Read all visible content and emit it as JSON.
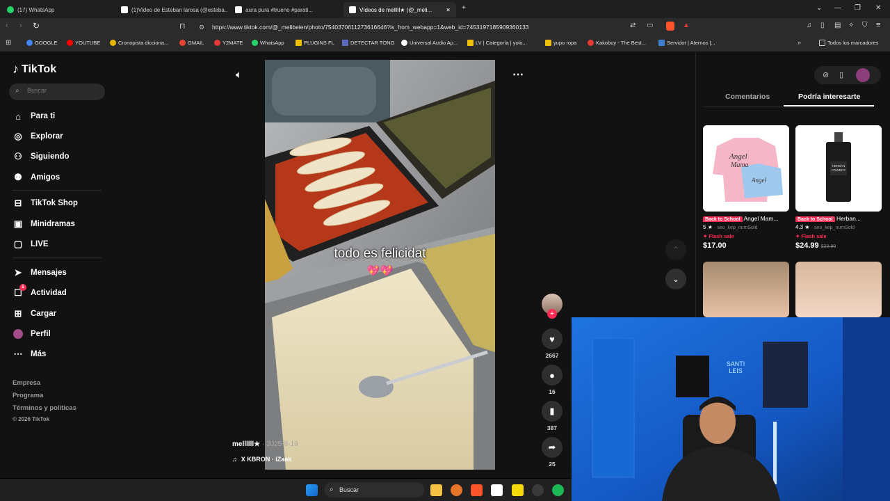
{
  "browser": {
    "tabs": [
      {
        "label": "(17) WhatsApp",
        "color": "#25d366"
      },
      {
        "label": "(1)Video de Esteban larosa (@esteba...",
        "color": "#000000"
      },
      {
        "label": "aura pura #trueno #parati...",
        "color": "#000000"
      },
      {
        "label": "Vídeos de melllll★ (@_meli...",
        "color": "#000000"
      }
    ],
    "url": "https://www.tiktok.com/@_melibelen/photo/7540370611273616646?is_from_webapp=1&web_id=7453197185909360133",
    "bookmarks": [
      {
        "label": "GOOGLE",
        "color": "#4285f4"
      },
      {
        "label": "YOUTUBE",
        "color": "#ff0000"
      },
      {
        "label": "Cronopista dicciona...",
        "color": "#e6b800"
      },
      {
        "label": "GMAIL",
        "color": "#ea4335"
      },
      {
        "label": "Y2MATE",
        "color": "#e53935"
      },
      {
        "label": "WhatsApp",
        "color": "#25d366"
      },
      {
        "label": "PLUGINS FL",
        "color": "#f0c000"
      },
      {
        "label": "DETECTAR TONO",
        "color": "#5c6bc0"
      },
      {
        "label": "Universal Audio Ap...",
        "color": "#ffffff"
      },
      {
        "label": "LV | Categoría | yolo...",
        "color": "#f0c000"
      },
      {
        "label": "yupo ropa",
        "color": "#f0c000"
      },
      {
        "label": "Kakobuy - The Best...",
        "color": "#e53935"
      },
      {
        "label": "Servidor | Aternos |...",
        "color": "#3f7fd0"
      }
    ],
    "bookmarks_folder": "Todos los marcadores"
  },
  "tiktok": {
    "logo": "TikTok",
    "search_placeholder": "Buscar",
    "nav": [
      {
        "label": "Para ti",
        "icon": "home-icon"
      },
      {
        "label": "Explorar",
        "icon": "compass-icon"
      },
      {
        "label": "Siguiendo",
        "icon": "following-icon"
      },
      {
        "label": "Amigos",
        "icon": "friends-icon"
      },
      {
        "label": "TikTok Shop",
        "icon": "shop-icon"
      },
      {
        "label": "Minidramas",
        "icon": "minidrama-icon"
      },
      {
        "label": "LIVE",
        "icon": "live-icon"
      },
      {
        "label": "Mensajes",
        "icon": "messages-icon"
      },
      {
        "label": "Actividad",
        "icon": "activity-icon",
        "badge": "1"
      },
      {
        "label": "Cargar",
        "icon": "upload-icon"
      },
      {
        "label": "Perfil",
        "icon": "profile-icon"
      },
      {
        "label": "Más",
        "icon": "more-icon"
      }
    ],
    "footer": [
      "Empresa",
      "Programa",
      "Términos y políticas",
      "© 2026 TikTok"
    ],
    "post": {
      "caption": "todo es felicidat",
      "emoji": "💖💖",
      "author": "mellllll★",
      "date": "2025-8-19",
      "music": "X KBRON · iZaak",
      "likes": "2667",
      "comments": "16",
      "saves": "387",
      "shares": "25"
    },
    "right_tabs": [
      "Comentarios",
      "Podría interesarte"
    ],
    "products": [
      {
        "badge": "Back to School",
        "title": "Angel Mam...",
        "rating": "5",
        "seller": "seo_kep_numSold",
        "flash": "Flash sale",
        "price": "$17.00",
        "old_price": ""
      },
      {
        "badge": "Back to School",
        "title": "Herban...",
        "rating": "4.3",
        "seller": "seo_kep_numSold",
        "flash": "Flash sale",
        "price": "$24.99",
        "old_price": "$29.99"
      }
    ]
  },
  "taskbar": {
    "search": "Buscar"
  }
}
